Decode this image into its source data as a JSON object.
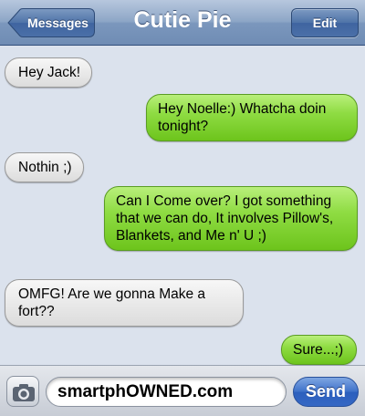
{
  "header": {
    "title": "Cutie Pie",
    "back_label": "Messages",
    "edit_label": "Edit"
  },
  "messages": [
    {
      "direction": "incoming",
      "text": "Hey Jack!"
    },
    {
      "direction": "outgoing",
      "text": "Hey Noelle:) Whatcha doin tonight?"
    },
    {
      "direction": "incoming",
      "text": "Nothin ;)"
    },
    {
      "direction": "outgoing",
      "text": "Can I Come over? I got something that we can do, It involves Pillow's, Blankets, and Me n' U ;)"
    },
    {
      "direction": "incoming",
      "text": "OMFG! Are we gonna Make a fort??"
    },
    {
      "direction": "outgoing",
      "text": "Sure...;)"
    }
  ],
  "composer": {
    "text": "smartphOWNED.com",
    "send_label": "Send",
    "camera_icon": "camera-icon"
  },
  "colors": {
    "outgoing_bubble": "#8fdc43",
    "incoming_bubble": "#e8e8e8",
    "background": "#dbe2ed",
    "navbar": "#7b97bd"
  }
}
